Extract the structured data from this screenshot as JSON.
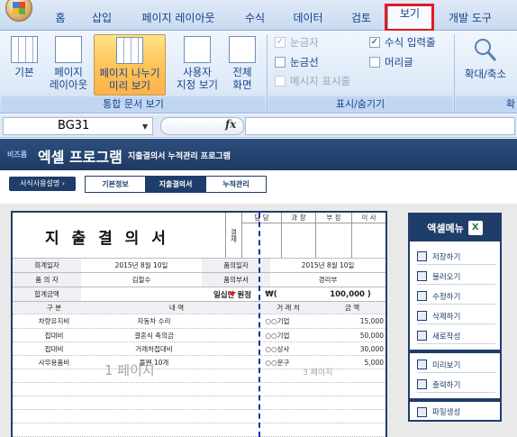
{
  "ribbon_tabs": [
    "홈",
    "삽입",
    "페이지 레이아웃",
    "수식",
    "데이터",
    "검토",
    "보기",
    "개발 도구"
  ],
  "active_tab": "보기",
  "ribbon": {
    "buttons": {
      "normal": "기본",
      "page_layout_l1": "페이지",
      "page_layout_l2": "레이아웃",
      "page_break_l1": "페이지 나누기",
      "page_break_l2": "미리 보기",
      "custom_l1": "사용자",
      "custom_l2": "지정 보기",
      "full_l1": "전체",
      "full_l2": "화면",
      "zoom": "확대/축소"
    },
    "checks": {
      "ruler": "눈금자",
      "formula_bar": "수식 입력줄",
      "gridlines": "눈금선",
      "headings": "머리글",
      "message_bar": "메시지 표시줄"
    },
    "groups": {
      "workbook_views": "통합 문서 보기",
      "show_hide": "표시/숨기기",
      "zoom_partial": "확"
    }
  },
  "formula_bar": {
    "name_box": "BG31",
    "fx": "fx",
    "value": ""
  },
  "app": {
    "logo": "비즈폼",
    "title": "엑셀 프로그램",
    "subtitle": "지출결의서 누적관리 프로그램",
    "help_button": "서식사용설명",
    "nav_tabs": [
      "기본정보",
      "지출결의서",
      "누적관리"
    ],
    "active_nav": "지출결의서"
  },
  "doc": {
    "title": "지 출 결 의 서",
    "approval_side": "결재",
    "approval_heads": [
      "담 당",
      "과 장",
      "부 장",
      "이 사"
    ],
    "info": {
      "account_date_label": "회계일자",
      "account_date": "2015년 8월 10일",
      "draft_date_label": "품의일자",
      "draft_date": "2015년 8월 10일",
      "drafter_label": "품 의 자",
      "drafter": "김철수",
      "dept_label": "품의부서",
      "dept": "경리부",
      "total_label": "합계금액",
      "total_words": "일십만 원정",
      "total_prefix": "₩(",
      "total_amount": "100,000 )"
    },
    "columns": [
      "구 분",
      "내 역",
      "거 래 처",
      "금 액"
    ],
    "rows": [
      {
        "category": "차량유지비",
        "detail": "자동차 수리",
        "vendor": "○○기업",
        "amount": "15,000"
      },
      {
        "category": "접대비",
        "detail": "결혼식 축의금",
        "vendor": "○○기업",
        "amount": "50,000"
      },
      {
        "category": "접대비",
        "detail": "거래처접대비",
        "vendor": "○○상사",
        "amount": "30,000"
      },
      {
        "category": "사무용품비",
        "detail": "볼펜 10개",
        "vendor": "○○문구",
        "amount": "5,000"
      }
    ],
    "page1": "1 페이지",
    "page3": "3 페이지"
  },
  "menu": {
    "title": "엑셀메뉴",
    "xl": "X",
    "items": [
      "저장하기",
      "불러오기",
      "수정하기",
      "삭제하기",
      "새로작성"
    ],
    "items2": [
      "미리보기",
      "출력하기"
    ],
    "items3": [
      "파일생성"
    ]
  }
}
